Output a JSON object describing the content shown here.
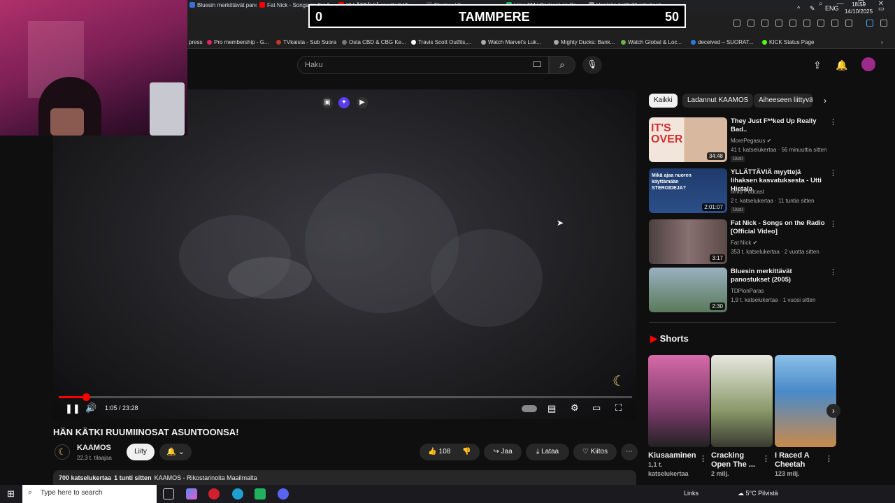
{
  "browser": {
    "tabs": [
      {
        "label": "Bluesin merkittävät panos...",
        "color": "#3b6fd6"
      },
      {
        "label": "Fat Nick - Songs on the R...",
        "color": "#ff0000"
      },
      {
        "label": "YLLÄTTÄVIÄ myyttejä liha...",
        "color": "#ff0000"
      },
      {
        "label": "Etusivu / X",
        "color": "#444444"
      },
      {
        "label": "Liiga FM | Podcast on Sp...",
        "color": "#1db954"
      },
      {
        "label": "Venäjän hallit 30 päivässä...",
        "color": "#888888"
      }
    ],
    "bookmarks": [
      {
        "label": "press",
        "color": "#888888"
      },
      {
        "label": "Pro membership - G...",
        "color": "#e0245e"
      },
      {
        "label": "TVkaista - Sub Suora",
        "color": "#c0392b"
      },
      {
        "label": "Osta CBD & CBG Ke...",
        "color": "#777777"
      },
      {
        "label": "Travis Scott Outfits,...",
        "color": "#ffffff"
      },
      {
        "label": "Watch Marvel's Luk...",
        "color": "#aaaaaa"
      },
      {
        "label": "Mighty Ducks: Bank...",
        "color": "#aaaaaa"
      },
      {
        "label": "Watch Global & Loc...",
        "color": "#6ab04c"
      },
      {
        "label": "deceived – SUORAT...",
        "color": "#2d7be0"
      },
      {
        "label": "KICK Status Page",
        "color": "#53fc18"
      }
    ]
  },
  "scoreboard": {
    "left_score": "0",
    "team": "TAMMPERE",
    "right_score": "50"
  },
  "header": {
    "search_placeholder": "Haku"
  },
  "player": {
    "time": "1:05 / 23:28",
    "progress": 0.047
  },
  "video": {
    "title": "HÄN KÄTKI RUUMIINOSAT ASUNTOONSA!",
    "channel": "KAAMOS",
    "subscribers": "22,3 t. tilaajaa",
    "join_label": "Liity",
    "likes": "108",
    "share_label": "Jaa",
    "download_label": "Lataa",
    "thanks_label": "Kiitos",
    "views": "700 katselukertaa",
    "published": "1 tunti sitten",
    "description_snippet": "KAAMOS - Rikostarinoita Maailmalta"
  },
  "chips": [
    "Kaikki",
    "Ladannut KAAMOS",
    "Aiheeseen liittyvä"
  ],
  "recommendations": [
    {
      "title": "They Just F**ked Up Really Bad..",
      "channel": "MorePegasus",
      "meta": "41 t. katselukertaa · 56 minuuttia sitten",
      "badge": "Uusi",
      "duration": "34:48",
      "thumb_text": "IT'S OVER",
      "thumb_color": "#d23030"
    },
    {
      "title": "YLLÄTTÄVIÄ myyttejä lihaksen kasvatuksesta - Utti Hietala",
      "channel": "Ilmiö Podcast",
      "meta": "2 t. katselukertaa · 11 tuntia sitten",
      "badge": "Uusi",
      "duration": "2:01:07",
      "thumb_text": "Mikä ajaa nuoren käyttämään STEROIDEJA?",
      "thumb_color": "#2c4f8a"
    },
    {
      "title": "Fat Nick - Songs on the Radio [Official Video]",
      "channel": "Fat Nick",
      "meta": "353 t. katselukertaa · 2 vuotta sitten",
      "badge": "",
      "duration": "3:17",
      "thumb_text": "",
      "thumb_color": "#6a5a55"
    },
    {
      "title": "Bluesin merkittävät panostukset (2005)",
      "channel": "TDPlonParas",
      "meta": "1,9 t. katselukertaa · 1 vuosi sitten",
      "badge": "",
      "duration": "2:30",
      "thumb_text": "",
      "thumb_color": "#5a7a5a"
    }
  ],
  "shorts": {
    "heading": "Shorts",
    "items": [
      {
        "title": "Kiusaaminen",
        "views": "1,1 t. katselukertaa",
        "color": "#c94a8a"
      },
      {
        "title": "Cracking Open The ...",
        "views": "2 milj.",
        "color": "#8a9a6a"
      },
      {
        "title": "I Raced A Cheetah",
        "views": "123 milj.",
        "color": "#4a8ac9"
      }
    ]
  },
  "taskbar": {
    "search_placeholder": "Type here to search",
    "links_label": "Links",
    "weather": "5°C  Pilvistä",
    "language": "ENG",
    "time": "18.59",
    "date": "14/10/2025"
  }
}
